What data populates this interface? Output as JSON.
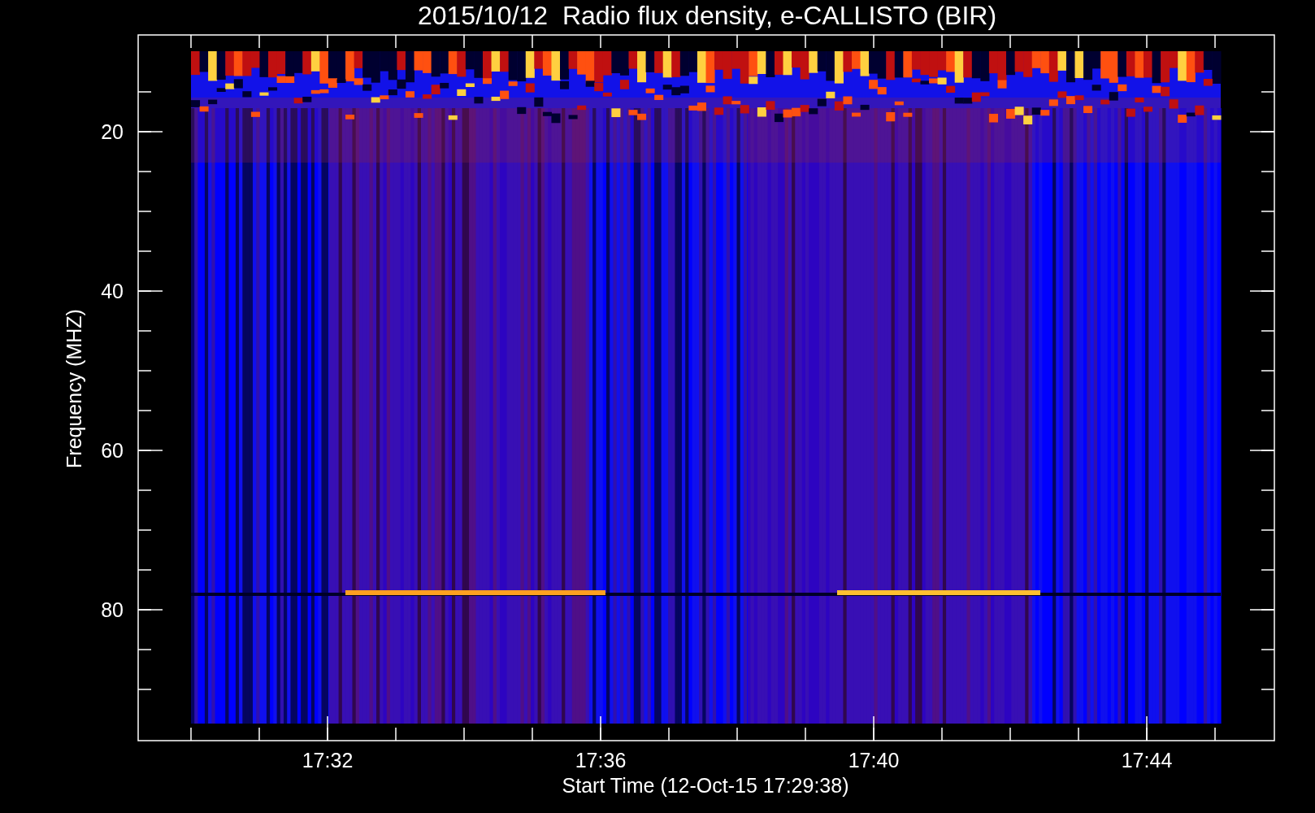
{
  "title": "2015/10/12  Radio flux density, e-CALLISTO (BIR)",
  "y_axis": {
    "label": "Frequency (MHZ)",
    "ticks": [
      "20",
      "40",
      "60",
      "80"
    ]
  },
  "x_axis": {
    "label": "Start Time (12-Oct-15 17:29:38)",
    "ticks": [
      "17:32",
      "17:36",
      "17:40",
      "17:44"
    ]
  }
}
